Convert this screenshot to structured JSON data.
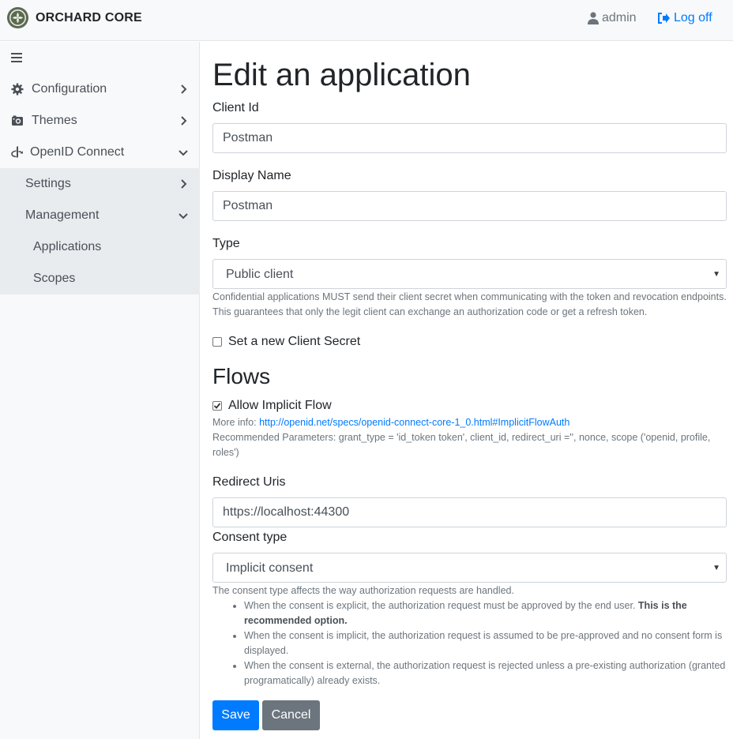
{
  "topbar": {
    "brand": "ORCHARD CORE",
    "user": "admin",
    "logoff": "Log off"
  },
  "sidebar": {
    "items": [
      {
        "label": "Configuration"
      },
      {
        "label": "Themes"
      },
      {
        "label": "OpenID Connect"
      },
      {
        "label": "Settings"
      },
      {
        "label": "Management"
      },
      {
        "label": "Applications"
      },
      {
        "label": "Scopes"
      }
    ]
  },
  "form": {
    "title": "Edit an application",
    "client_id_label": "Client Id",
    "client_id_value": "Postman",
    "display_name_label": "Display Name",
    "display_name_value": "Postman",
    "type_label": "Type",
    "type_value": "Public client",
    "type_help": "Confidential applications MUST send their client secret when communicating with the token and revocation endpoints. This guarantees that only the legit client can exchange an authorization code or get a refresh token.",
    "new_secret_label": "Set a new Client Secret",
    "flows_title": "Flows",
    "implicit_flow_label": "Allow Implicit Flow",
    "more_info_prefix": "More info: ",
    "more_info_link": "http://openid.net/specs/openid-connect-core-1_0.html#ImplicitFlowAuth",
    "recommended_params": "Recommended Parameters: grant_type = 'id_token token', client_id, redirect_uri ='', nonce, scope ('openid, profile, roles')",
    "redirect_uris_label": "Redirect Uris",
    "redirect_uris_value": "https://localhost:44300",
    "consent_type_label": "Consent type",
    "consent_type_value": "Implicit consent",
    "consent_help": "The consent type affects the way authorization requests are handled.",
    "consent_bullets": {
      "explicit": "When the consent is explicit, the authorization request must be approved by the end user. ",
      "explicit_bold": "This is the recommended option.",
      "implicit": "When the consent is implicit, the authorization request is assumed to be pre-approved and no consent form is displayed.",
      "external": "When the consent is external, the authorization request is rejected unless a pre-existing authorization (granted programatically) already exists."
    },
    "save_label": "Save",
    "cancel_label": "Cancel"
  },
  "colors": {
    "primary": "#007bff",
    "secondary": "#6c757d",
    "sidebar_bg": "#f8f9fa",
    "subnav_bg": "#e9ecef"
  }
}
